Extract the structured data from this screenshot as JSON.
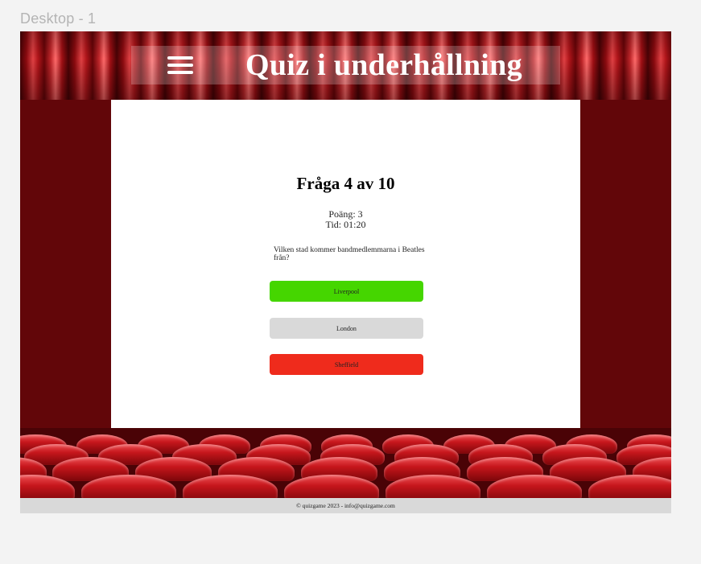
{
  "canvas": {
    "frame_label": "Desktop - 1"
  },
  "header": {
    "title": "Quiz i underhållning",
    "menu_icon": "hamburger-menu-icon"
  },
  "quiz": {
    "heading": "Fråga 4 av 10",
    "score": "Poäng: 3",
    "time": "Tid: 01:20",
    "question": "Vilken stad kommer bandmedlemmarna i Beatles från?",
    "answers": [
      {
        "label": "Liverpool",
        "state": "correct",
        "color": "#45d600"
      },
      {
        "label": "London",
        "state": "neutral",
        "color": "#d9d9d9"
      },
      {
        "label": "Sheffield",
        "state": "wrong",
        "color": "#ef2b1c"
      }
    ]
  },
  "footer": {
    "text": "© quizgame 2023 - info@quizgame.com"
  },
  "colors": {
    "side_background": "#620609",
    "card_background": "#ffffff",
    "footer_background": "#d9d9d9"
  }
}
